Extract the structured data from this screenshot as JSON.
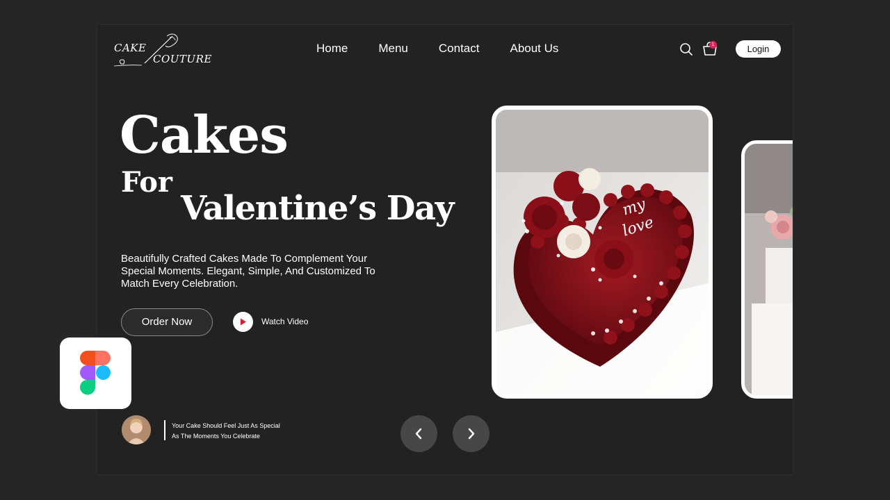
{
  "logo": {
    "line1": "CAKE",
    "line2": "COUTURE"
  },
  "nav": {
    "items": [
      "Home",
      "Menu",
      "Contact",
      "About Us"
    ]
  },
  "header": {
    "cart_count": "1",
    "login_label": "Login"
  },
  "hero": {
    "title_line1": "Cakes",
    "title_line2": "For",
    "title_line3": "Valentine’s Day",
    "description": "Beautifully Crafted Cakes Made To Complement Your Special Moments. Elegant, Simple, And Customized To Match Every Celebration.",
    "order_label": "Order Now",
    "watch_label": "Watch Video"
  },
  "cake_topper": {
    "line1": "my",
    "line2": "love"
  },
  "testimonial": {
    "line1": "Your Cake Should Feel Just As Special",
    "line2": "As The Moments You Celebrate"
  },
  "colors": {
    "background": "#222222",
    "accent": "#d6275a",
    "cake_red": "#7e0f16"
  },
  "icons": [
    "search-icon",
    "cart-icon",
    "play-icon",
    "chevron-left-icon",
    "chevron-right-icon",
    "figma-logo-icon"
  ]
}
